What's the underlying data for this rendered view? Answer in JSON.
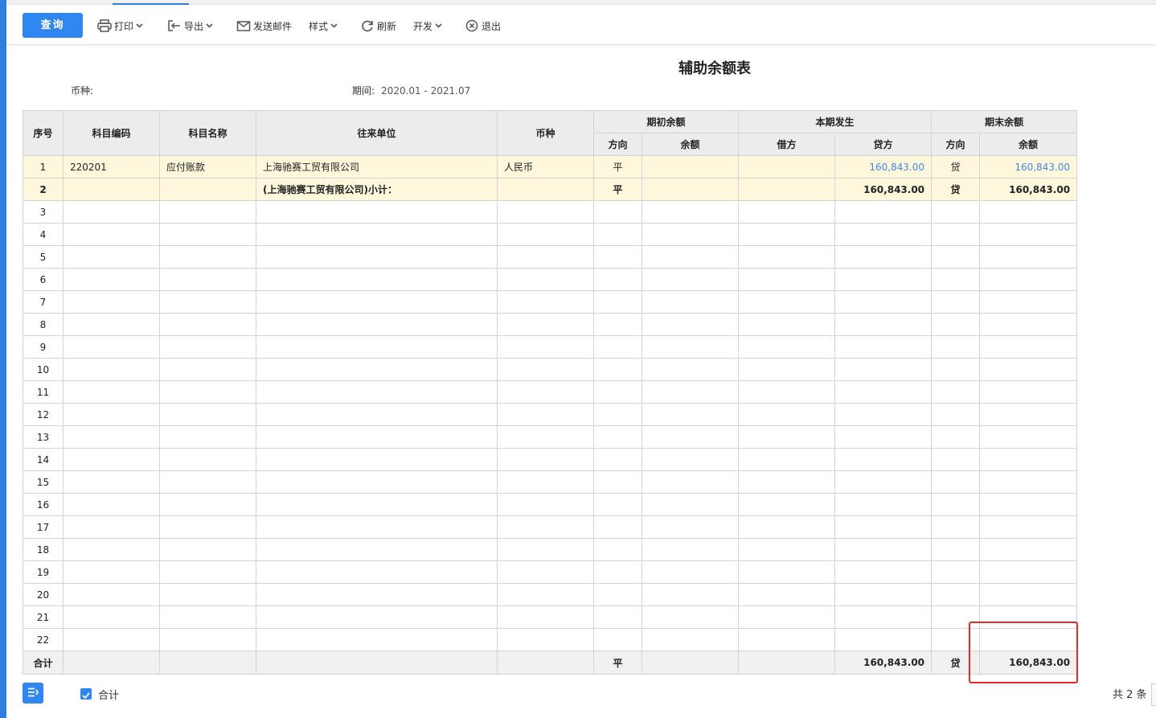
{
  "toolbar": {
    "query": "查询",
    "print": "打印",
    "export": "导出",
    "send_mail": "发送邮件",
    "style": "样式",
    "refresh": "刷新",
    "develop": "开发",
    "exit": "退出"
  },
  "report": {
    "title": "辅助余额表",
    "currency_label": "币种:",
    "currency_value": "",
    "period_label": "期间:",
    "period_value": "2020.01 - 2021.07"
  },
  "table": {
    "headers": {
      "seq": "序号",
      "account_code": "科目编码",
      "account_name": "科目名称",
      "partner": "往来单位",
      "currency": "币种",
      "opening": "期初余额",
      "current": "本期发生",
      "closing": "期末余额",
      "opening_dir": "方向",
      "opening_amt": "余额",
      "debit": "借方",
      "credit": "贷方",
      "closing_dir": "方向",
      "closing_amt": "余额"
    },
    "rows": [
      {
        "seq": "1",
        "code": "220201",
        "name": "应付账款",
        "partner": "上海驰赛工贸有限公司",
        "currency": "人民币",
        "open_dir": "平",
        "open_amt": "",
        "debit": "",
        "credit": "160,843.00",
        "close_dir": "贷",
        "close_amt": "160,843.00"
      },
      {
        "seq": "2",
        "code": "",
        "name": "",
        "partner": "(上海驰赛工贸有限公司)小计：",
        "currency": "",
        "open_dir": "平",
        "open_amt": "",
        "debit": "",
        "credit": "160,843.00",
        "close_dir": "贷",
        "close_amt": "160,843.00"
      }
    ],
    "empty_row_numbers": [
      "3",
      "4",
      "5",
      "6",
      "7",
      "8",
      "9",
      "10",
      "11",
      "12",
      "13",
      "14",
      "15",
      "16",
      "17",
      "18",
      "19",
      "20",
      "21",
      "22"
    ],
    "total": {
      "label": "合计",
      "open_dir": "平",
      "credit": "160,843.00",
      "close_dir": "贷",
      "close_amt": "160,843.00"
    }
  },
  "footer": {
    "sum_checkbox_label": "合计",
    "count_text": "共 2 条"
  },
  "colors": {
    "accent": "#2f86f0",
    "highlight_row": "#fdf7dc",
    "link_blue": "#4a86e8",
    "annotation_red": "#e8262c"
  }
}
